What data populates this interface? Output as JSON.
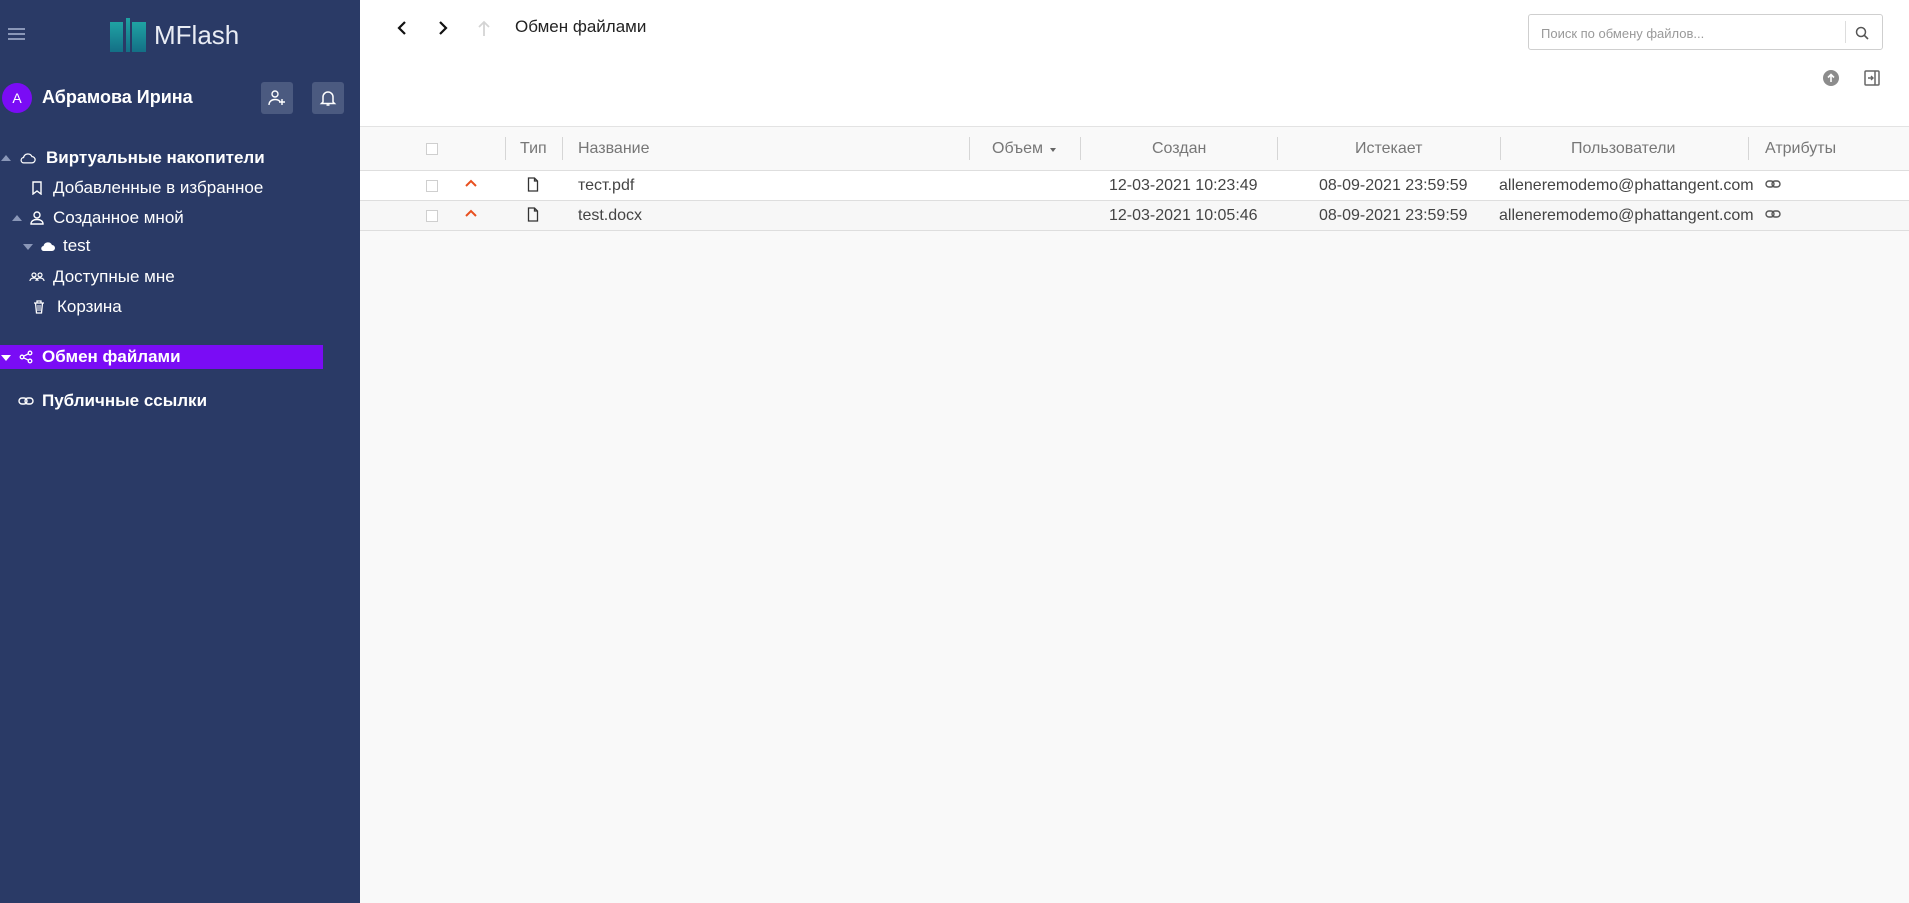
{
  "app": {
    "title": "MFlash"
  },
  "user": {
    "initial": "А",
    "name": "Абрамова Ирина"
  },
  "sidebar": {
    "items": [
      {
        "label": "Виртуальные накопители",
        "icon": "cloud-outline-icon"
      },
      {
        "label": "Добавленные в избранное",
        "icon": "bookmark-icon"
      },
      {
        "label": "Созданное мной",
        "icon": "person-icon"
      },
      {
        "label": "test",
        "icon": "cloud-icon"
      },
      {
        "label": "Доступные мне",
        "icon": "people-icon"
      },
      {
        "label": "Корзина",
        "icon": "trash-icon"
      },
      {
        "label": "Обмен файлами",
        "icon": "share-icon"
      },
      {
        "label": "Публичные ссылки",
        "icon": "link-icon"
      }
    ]
  },
  "header": {
    "breadcrumb": "Обмен файлами",
    "search_placeholder": "Поиск по обмену файлов..."
  },
  "table": {
    "columns": {
      "type": "Тип",
      "name": "Название",
      "size": "Объем",
      "created": "Создан",
      "expires": "Истекает",
      "users": "Пользователи",
      "attributes": "Атрибуты"
    },
    "rows": [
      {
        "name": "тест.pdf",
        "created": "12-03-2021 10:23:49",
        "expires": "08-09-2021 23:59:59",
        "user": "alleneremodemo@phattangent.com"
      },
      {
        "name": "test.docx",
        "created": "12-03-2021 10:05:46",
        "expires": "08-09-2021 23:59:59",
        "user": "alleneremodemo@phattangent.com"
      }
    ]
  },
  "colors": {
    "sidebar_bg": "#2a3a66",
    "accent": "#7a0cf5",
    "priority": "#e8501f"
  }
}
